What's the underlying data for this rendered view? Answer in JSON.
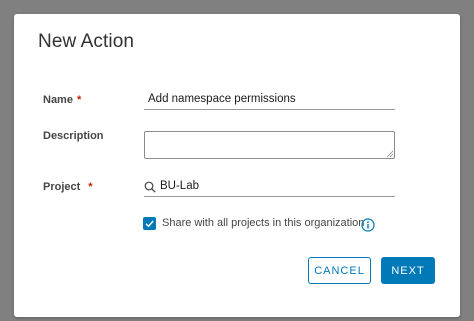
{
  "dialog": {
    "title": "New Action",
    "fields": {
      "name": {
        "label": "Name",
        "required_marker": "*",
        "value": "Add namespace permissions"
      },
      "description": {
        "label": "Description",
        "value": ""
      },
      "project": {
        "label": "Project",
        "required_marker": "*",
        "value": "BU-Lab",
        "icon": "search-icon"
      }
    },
    "share_checkbox": {
      "label": "Share with all projects in this organization",
      "checked": true,
      "icon": "info-icon"
    },
    "buttons": {
      "cancel": "CANCEL",
      "next": "NEXT"
    }
  },
  "colors": {
    "accent": "#0079b8",
    "required": "#c92100",
    "overlay": "#808080"
  }
}
